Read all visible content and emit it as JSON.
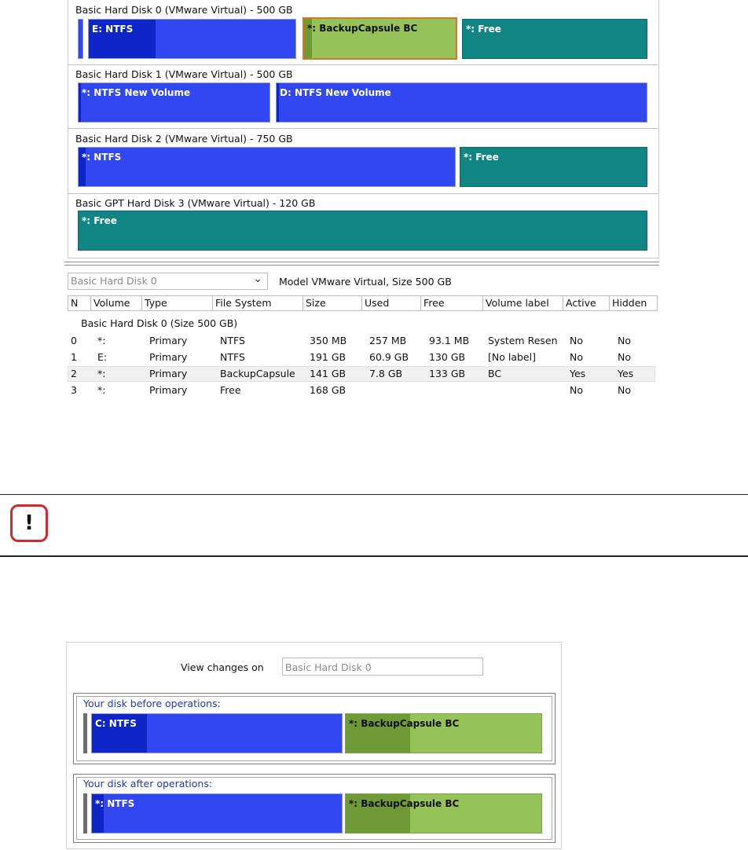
{
  "top_disks": [
    {
      "title": "Basic Hard Disk 0 (VMware Virtual) - 500 GB",
      "partitions": [
        "E: NTFS",
        "*: BackupCapsule BC",
        "*: Free"
      ]
    },
    {
      "title": "Basic Hard Disk 1 (VMware Virtual) - 500 GB",
      "partitions": [
        "*: NTFS New Volume",
        "D: NTFS New Volume"
      ]
    },
    {
      "title": "Basic Hard Disk 2 (VMware Virtual) - 750 GB",
      "partitions": [
        "*: NTFS",
        "*: Free"
      ]
    },
    {
      "title": "Basic GPT Hard Disk 3 (VMware Virtual) - 120 GB",
      "partitions": [
        "*: Free"
      ]
    }
  ],
  "disk_selector": {
    "value": "Basic Hard Disk 0",
    "chevron": "⌄"
  },
  "model_info": "Model VMware Virtual, Size 500 GB",
  "table": {
    "columns": [
      "N",
      "Volume",
      "Type",
      "File System",
      "Size",
      "Used",
      "Free",
      "Volume label",
      "Active",
      "Hidden"
    ],
    "group_label": "Basic Hard Disk 0 (Size 500 GB)",
    "rows": [
      [
        "0",
        "*:",
        "Primary",
        "NTFS",
        "350 MB",
        "257 MB",
        "93.1 MB",
        "System Resen",
        "No",
        "No"
      ],
      [
        "1",
        "E:",
        "Primary",
        "NTFS",
        "191 GB",
        "60.9 GB",
        "130 GB",
        "[No label]",
        "No",
        "No"
      ],
      [
        "2",
        "*:",
        "Primary",
        "BackupCapsule",
        "141 GB",
        "7.8 GB",
        "133 GB",
        "BC",
        "Yes",
        "Yes"
      ],
      [
        "3",
        "*:",
        "Primary",
        "Free",
        "168 GB",
        "",
        "",
        "",
        "No",
        "No"
      ]
    ],
    "selected_row": 2
  },
  "warning": {
    "icon": "exclamation-icon",
    "text": "!"
  },
  "preview": {
    "view_changes_label": "View changes on",
    "view_changes_value": "Basic Hard Disk 0",
    "before": {
      "title": "Your disk before operations:",
      "left": "C: NTFS",
      "right": "*: BackupCapsule BC"
    },
    "after": {
      "title": "Your disk after operations:",
      "left": "*: NTFS",
      "right": "*: BackupCapsule BC"
    }
  },
  "colors": {
    "partition_blue": "#3047f2",
    "used_blue": "#0e26c7",
    "free_teal": "#118583",
    "backup_green": "#96c25a",
    "warning_red": "#d22a2a"
  }
}
